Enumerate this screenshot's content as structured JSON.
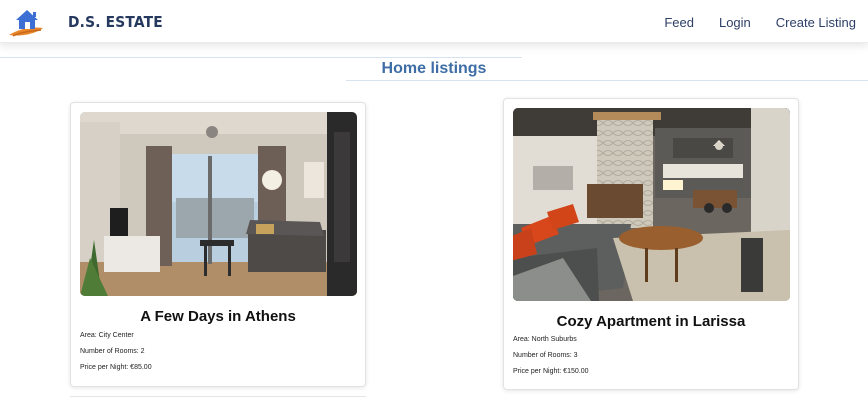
{
  "brand": {
    "name": "D.S. ESTATE"
  },
  "nav": {
    "links": [
      "Feed",
      "Login",
      "Create Listing"
    ]
  },
  "main": {
    "title": "Home listings"
  },
  "listings": [
    {
      "title": "A Few Days in Athens",
      "area": "Area: City Center",
      "rooms": "Number of Rooms: 2",
      "price": "Price per Night: €85.00"
    },
    {
      "title": "Cozy Apartment in Larissa",
      "area": "Area: North Suburbs",
      "rooms": "Number of Rooms: 3",
      "price": "Price per Night: €150.00"
    }
  ],
  "colors": {
    "brand": "#25385e",
    "title": "#3f6ea6",
    "logo_blue": "#3b6fd4",
    "logo_orange": "#e8862a"
  },
  "icons": [
    "house-logo-icon"
  ]
}
